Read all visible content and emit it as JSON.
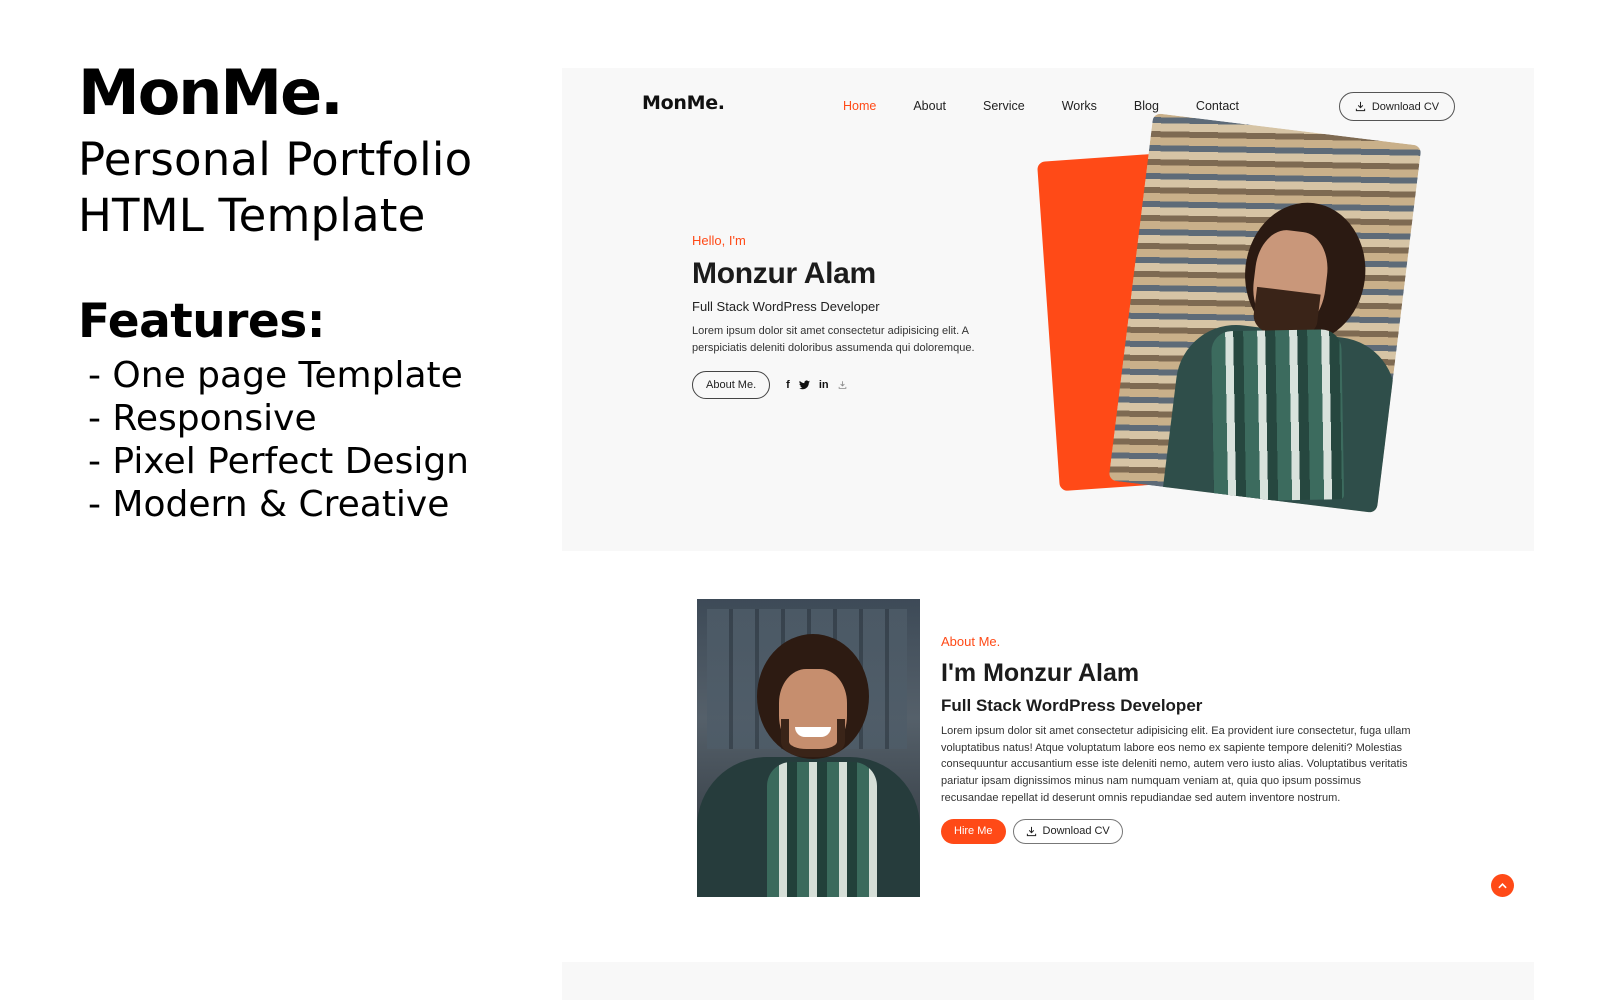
{
  "promo": {
    "brand": "MonMe.",
    "title_line1": "Personal Portfolio",
    "title_line2": "HTML Template",
    "features_heading": "Features:",
    "features": [
      "- One page Template",
      "- Responsive",
      "- Pixel Perfect Design",
      "- Modern & Creative"
    ]
  },
  "hero": {
    "nav": {
      "logo": "MonMe.",
      "items": [
        {
          "label": "Home",
          "active": true
        },
        {
          "label": "About",
          "active": false
        },
        {
          "label": "Service",
          "active": false
        },
        {
          "label": "Works",
          "active": false
        },
        {
          "label": "Blog",
          "active": false
        },
        {
          "label": "Contact",
          "active": false
        }
      ],
      "download_cv": "Download CV",
      "download_icon": "download-icon"
    },
    "greeting": "Hello, I'm",
    "name": "Monzur Alam",
    "role": "Full Stack WordPress Developer",
    "description": "Lorem ipsum dolor sit amet consectetur adipisicing elit. A perspiciatis deleniti doloribus assumenda qui doloremque.",
    "about_button": "About Me.",
    "social": [
      {
        "icon": "facebook-icon",
        "glyph": "f"
      },
      {
        "icon": "twitter-icon",
        "glyph": "❧"
      },
      {
        "icon": "linkedin-icon",
        "glyph": "in"
      },
      {
        "icon": "youtube-icon",
        "glyph": "▶"
      }
    ]
  },
  "about": {
    "eyebrow": "About Me.",
    "name": "I'm Monzur Alam",
    "role": "Full Stack WordPress Developer",
    "description": "Lorem ipsum dolor sit amet consectetur adipisicing elit. Ea provident iure consectetur, fuga ullam voluptatibus natus! Atque voluptatum labore eos nemo ex sapiente tempore deleniti? Molestias consequuntur accusantium esse iste deleniti nemo, autem vero iusto alias. Voluptatibus veritatis pariatur ipsam dignissimos minus nam numquam veniam at, quia quo ipsum possimus recusandae repellat id deserunt omnis repudiandae sed autem inventore nostrum.",
    "hire_button": "Hire Me",
    "download_cv": "Download CV"
  },
  "scroll_top_icon": "˄",
  "colors": {
    "accent": "#ff4a17",
    "section_bg": "#f8f8f8",
    "text": "#1c1c1c"
  }
}
